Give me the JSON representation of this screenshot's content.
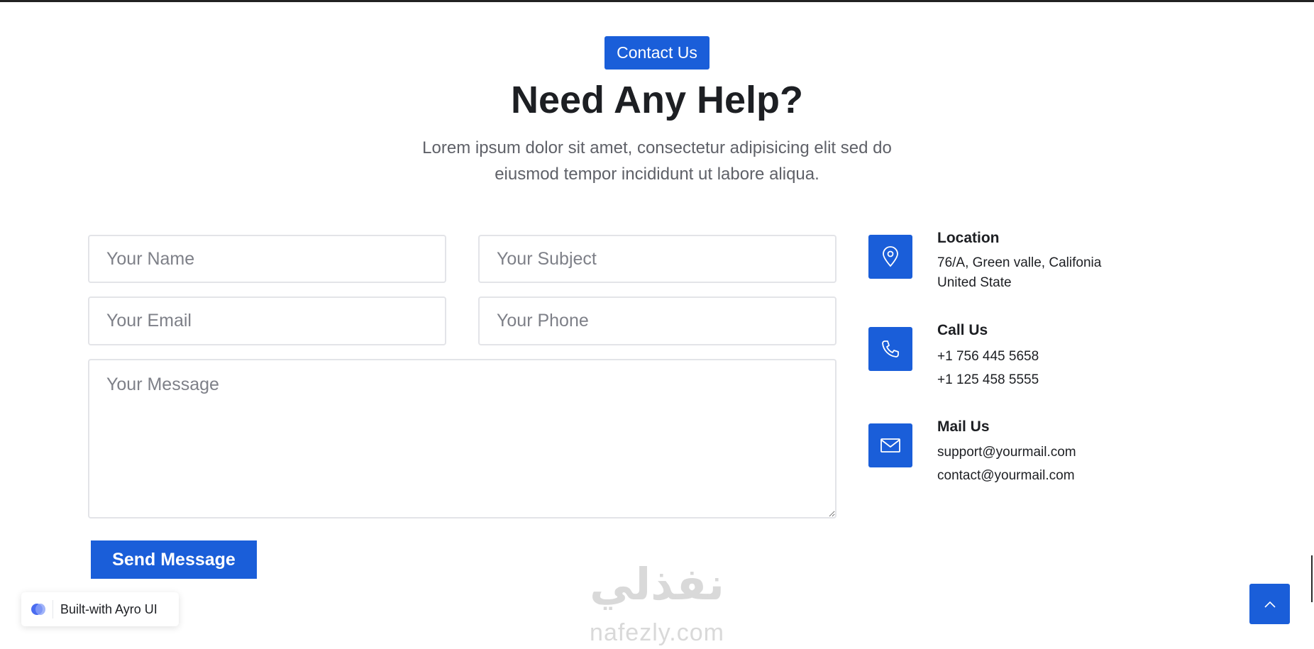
{
  "header": {
    "badge": "Contact Us",
    "title": "Need Any Help?",
    "subtitle": "Lorem ipsum dolor sit amet, consectetur adipisicing elit sed do eiusmod tempor incididunt ut labore aliqua."
  },
  "form": {
    "name_placeholder": "Your Name",
    "subject_placeholder": "Your Subject",
    "email_placeholder": "Your Email",
    "phone_placeholder": "Your Phone",
    "message_placeholder": "Your Message",
    "submit_label": "Send Message"
  },
  "contact_info": {
    "location": {
      "title": "Location",
      "line1": "76/A, Green valle, Califonia",
      "line2": "United State",
      "icon": "map-pin-icon"
    },
    "call": {
      "title": "Call Us",
      "line1": "+1 756 445 5658",
      "line2": "+1 125 458 5555",
      "icon": "phone-icon"
    },
    "mail": {
      "title": "Mail Us",
      "line1": "support@yourmail.com",
      "line2": "contact@yourmail.com",
      "icon": "mail-icon"
    }
  },
  "footer": {
    "built_with": "Built-with Ayro UI",
    "watermark_arabic": "نفذلي",
    "watermark_latin": "nafezly.com"
  },
  "colors": {
    "accent": "#1a5ed9",
    "heading": "#1d1f23",
    "body_text": "#5f6168",
    "border": "#e3e4e8"
  }
}
